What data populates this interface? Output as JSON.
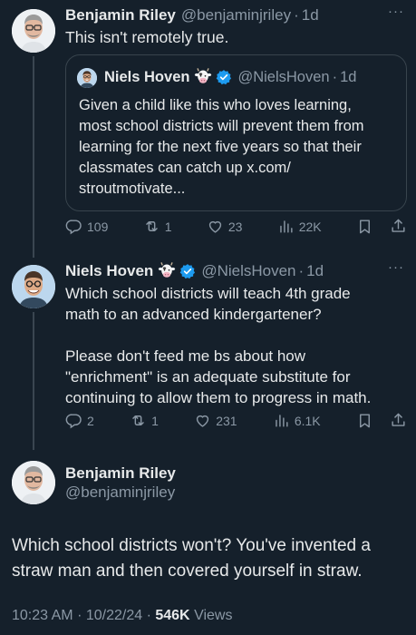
{
  "tweet1": {
    "name": "Benjamin Riley",
    "handle": "@benjaminjriley",
    "sep": "·",
    "time": "1d",
    "text": "This isn't remotely true.",
    "quote": {
      "name": "Niels Hoven",
      "emoji": "cow-face",
      "verified": true,
      "handle": "@NielsHoven",
      "sep": "·",
      "time": "1d",
      "text": "Given a child like this who loves learning,\nmost school districts will prevent them from\nlearning for the next five years so that their\nclassmates can catch up x.com/\nstroutmotivate..."
    },
    "stats": {
      "replies": "109",
      "reposts": "1",
      "likes": "23",
      "views": "22K"
    }
  },
  "tweet2": {
    "name": "Niels Hoven",
    "emoji": "cow-face",
    "verified": true,
    "handle": "@NielsHoven",
    "sep": "·",
    "time": "1d",
    "text": "Which school districts will teach 4th grade\nmath to an advanced kindergartener?\n\nPlease don't feed me bs about how\n\"enrichment\" is an adequate substitute for\ncontinuing to allow them to progress in math.",
    "stats": {
      "replies": "2",
      "reposts": "1",
      "likes": "231",
      "views": "6.1K"
    }
  },
  "main": {
    "name": "Benjamin Riley",
    "handle": "@benjaminjriley",
    "text": "Which school districts won't? You've invented a\nstraw man and then covered yourself in straw.",
    "time": "10:23 AM",
    "date": "10/22/24",
    "sep": "·",
    "views_count": "546K",
    "views_label": "Views"
  },
  "colors": {
    "background": "#15202b",
    "muted": "#8b98a5",
    "text": "#e7e9ea",
    "verified": "#1d9bf0",
    "border": "#38444d"
  },
  "icons": [
    "more-icon",
    "reply-icon",
    "repost-icon",
    "like-icon",
    "views-icon",
    "bookmark-icon",
    "share-icon",
    "verified-badge-icon",
    "cow-emoji-icon"
  ]
}
